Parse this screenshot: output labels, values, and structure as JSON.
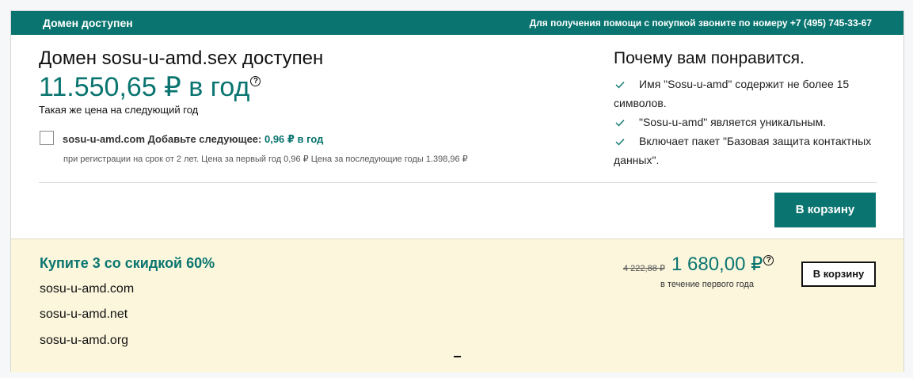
{
  "header": {
    "title": "Домен доступен",
    "help_text": "Для получения помощи с покупкой звоните по номеру +7 (495) 745-33-67"
  },
  "domain": {
    "title": "Домен sosu-u-amd.sex доступен",
    "price": "11.550,65 ₽ в год",
    "price_help_icon": "?",
    "renew_note": "Такая же цена на следующий год"
  },
  "addon": {
    "checked": false,
    "domain": "sosu-u-amd.com",
    "label": "Добавьте следующее:",
    "price": "0,96 ₽ в год",
    "note": "при регистрации на срок от 2 лет. Цена за первый год 0,96 ₽ Цена за последующие годы 1.398,96 ₽"
  },
  "why": {
    "title": "Почему вам понравится.",
    "items": [
      {
        "icon": "check-icon",
        "text": "Имя \"Sosu-u-amd\" содержит не более 15 символов."
      },
      {
        "icon": "check-icon",
        "text": "\"Sosu-u-amd\" является уникальным."
      },
      {
        "icon": "check-icon",
        "text": "Включает пакет \"Базовая защита контактных данных\"."
      }
    ]
  },
  "cart_button": "В корзину",
  "promo": {
    "title": "Купите 3 со скидкой 60%",
    "domains": [
      "sosu-u-amd.com",
      "sosu-u-amd.net",
      "sosu-u-amd.org"
    ],
    "old_price": "4 222,88 ₽",
    "new_price": "1 680,00 ₽",
    "help_icon": "?",
    "period": "в течение первого года",
    "button": "В корзину",
    "bottom_mark": "–"
  },
  "colors": {
    "accent": "#0a7570",
    "promo_bg": "#fbf6dc",
    "page_bg": "#f5f7f8"
  }
}
